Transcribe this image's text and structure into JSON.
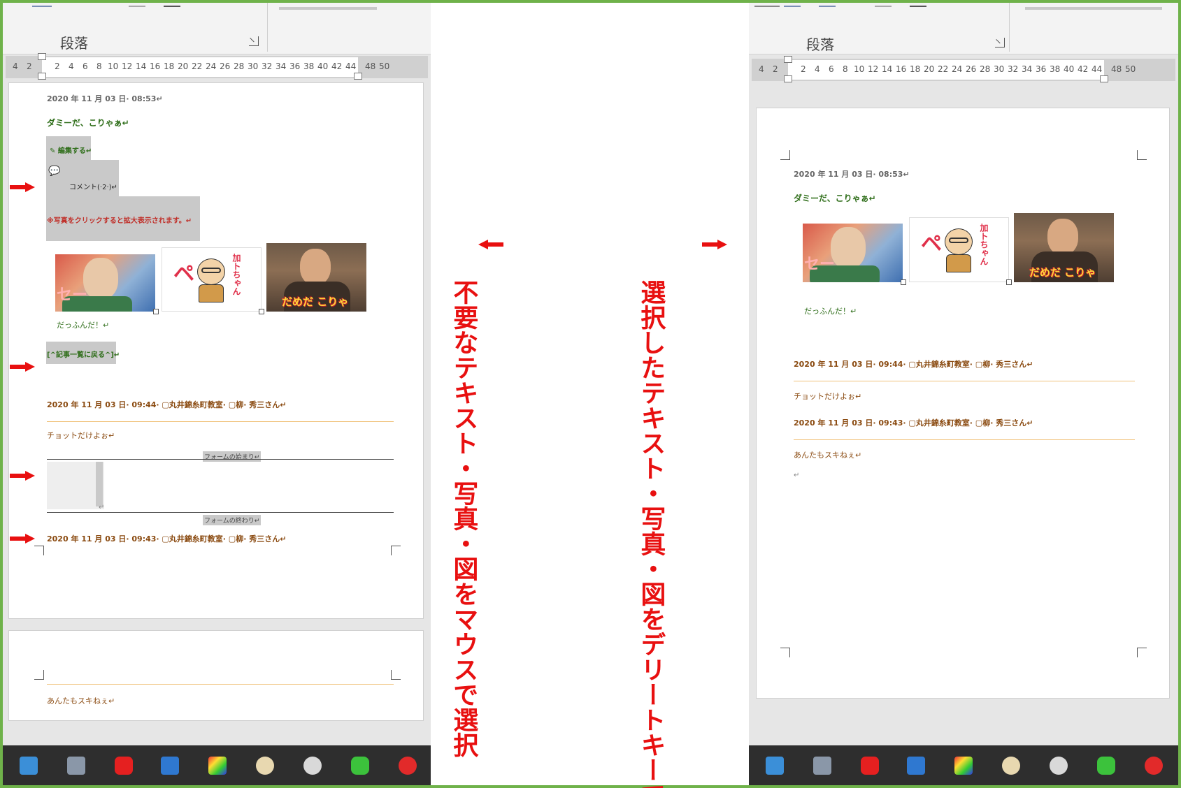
{
  "ribbon": {
    "group_label": "段落"
  },
  "ruler": {
    "numbers": [
      "4",
      "2",
      "2",
      "4",
      "6",
      "8",
      "10",
      "12",
      "14",
      "16",
      "18",
      "20",
      "22",
      "24",
      "26",
      "28",
      "30",
      "32",
      "34",
      "36",
      "38",
      "40",
      "42",
      "44",
      "48",
      "50"
    ]
  },
  "document": {
    "post_meta": "2020 年 11 月 03 日· 08:53↵",
    "post_title": "ダミーだ、こりゃぁ↵",
    "edit_link": "編集する↵",
    "comment_link": "コメント(·2·)↵",
    "photo_note": "※写真をクリックすると拡大表示されます。↵",
    "photo3_caption": "だめだ こりゃ",
    "photo2_caption": "加トちゃん",
    "photo1_caption": "セー",
    "tagline": "だっふんだ！↵",
    "back_link": "[^記事一覧に戻る^]↵",
    "comment1_meta": "2020 年 11 月 03 日· 09:44· ▢丸井錦糸町教室· ▢柳· 秀三さん↵",
    "comment1_text": "チョットだけよぉ↵",
    "form_start": "フォームの始まり↵",
    "form_end": "フォームの終わり↵",
    "comment2_meta": "2020 年 11 月 03 日· 09:43· ▢丸井錦糸町教室· ▢柳· 秀三さん↵",
    "comment2_text": "あんたもスキねぇ↵",
    "empty_para": "↵"
  },
  "instructions": {
    "left": "不要なテキスト・写真・図をマウスで選択",
    "right": "選択したテキスト・写真・図をデリートキーで削除するとシンプルになる"
  },
  "colors": {
    "arrow": "#e81010",
    "frame": "#6fb24a",
    "selection": "#c9c9c9"
  },
  "taskbar_icons": [
    "contact-card-icon",
    "computer-icon",
    "youtube-icon",
    "photos-icon",
    "color-palette-icon",
    "paint-icon",
    "umbrella-icon",
    "line-icon",
    "daruma-icon"
  ]
}
